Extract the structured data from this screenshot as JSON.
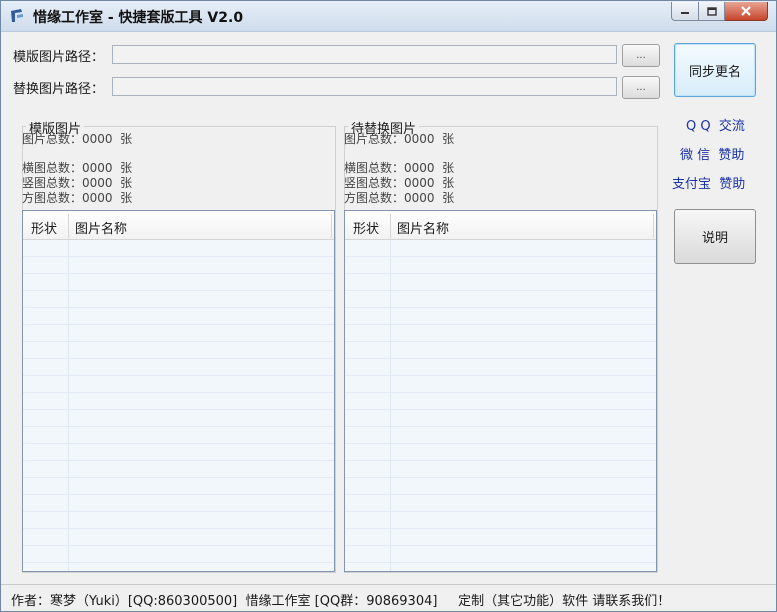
{
  "window": {
    "title": "惜缘工作室 - 快捷套版工具 V2.0"
  },
  "template_path": {
    "label": "模版图片路径：",
    "value": "",
    "browse_label": "..."
  },
  "replace_path": {
    "label": "替换图片路径：",
    "value": "",
    "browse_label": "..."
  },
  "buttons": {
    "sync_rename": "同步更名",
    "instructions": "说明"
  },
  "side_links": {
    "qq_exchange": "Q Q  交流",
    "wechat_donate": "微 信  赞助",
    "alipay_donate": "支付宝  赞助"
  },
  "template_group": {
    "title": "模版图片",
    "total": "图片总数：0000  张",
    "landscape": "横图总数：0000  张",
    "portrait": "竖图总数：0000  张",
    "square": "方图总数：0000  张",
    "columns": [
      "形状",
      "图片名称"
    ]
  },
  "replace_group": {
    "title": "待替换图片",
    "total": "图片总数：0000  张",
    "landscape": "横图总数：0000  张",
    "portrait": "竖图总数：0000  张",
    "square": "方图总数：0000  张",
    "columns": [
      "形状",
      "图片名称"
    ]
  },
  "status_bar": {
    "text": "作者：寒梦（Yuki）[QQ:860300500]  惜缘工作室 [QQ群：90869304]     定制（其它功能）软件 请联系我们！"
  },
  "colors": {
    "link": "#1a33a8",
    "titlebar": "#cfdcec",
    "close_button": "#c6462c"
  }
}
